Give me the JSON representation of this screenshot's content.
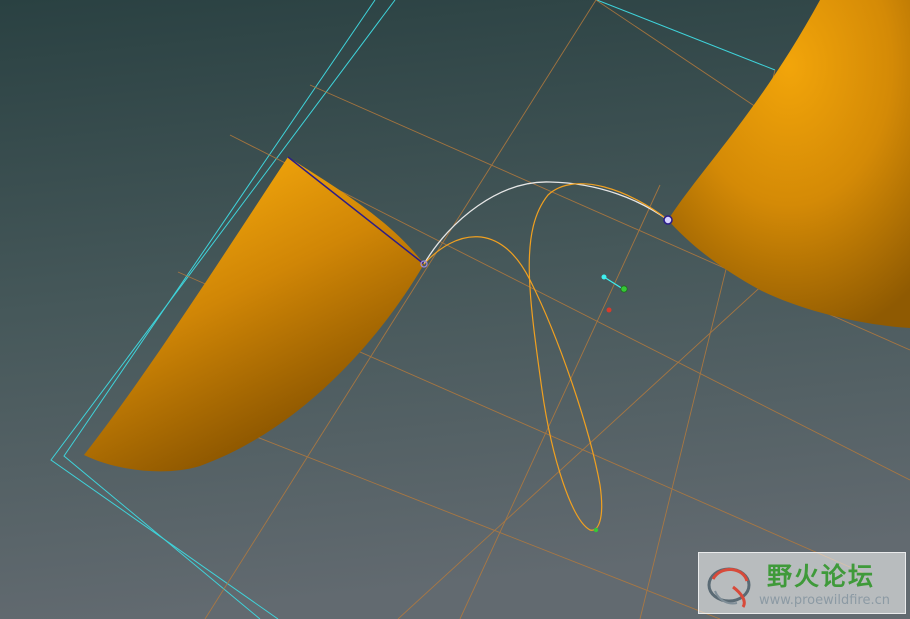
{
  "viewport": {
    "background_top": "#2c4344",
    "background_bottom": "#5d6469"
  },
  "colors": {
    "surface_light": "#f0a20a",
    "surface_mid": "#d48a06",
    "surface_dark": "#8f5a02",
    "datum_plane_cyan": "#3fd3da",
    "datum_plane_orange": "#b87a3e",
    "curve_orange": "#f0a020",
    "curve_white": "#e6e6e6",
    "edge_blue": "#2b1d8a",
    "handle_cyan": "#3ef0f0",
    "handle_green": "#36c836",
    "handle_red": "#d83a2a"
  },
  "watermark": {
    "title": "野火论坛",
    "url": "www.proewildfire.cn",
    "title_color": "#3f9a3a",
    "logo_icon": "swirl-logo-icon"
  }
}
